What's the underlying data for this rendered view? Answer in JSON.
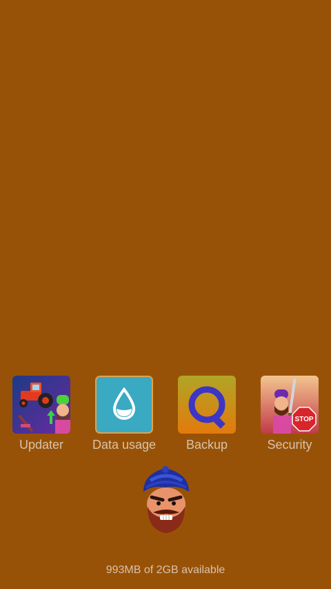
{
  "apps": [
    {
      "label": "Updater",
      "icon": "updater-tractor-icon"
    },
    {
      "label": "Data usage",
      "icon": "water-drop-icon"
    },
    {
      "label": "Backup",
      "icon": "backup-q-icon"
    },
    {
      "label": "Security",
      "icon": "security-stop-icon"
    }
  ],
  "mascot": {
    "icon": "turbaned-man-mascot-icon"
  },
  "storage": {
    "text": "993MB of 2GB available"
  },
  "colors": {
    "background": "#985207",
    "label": "#d7c3ad",
    "data_usage_tile": "#3aa9c2",
    "backup_ring": "#3c35c6"
  }
}
